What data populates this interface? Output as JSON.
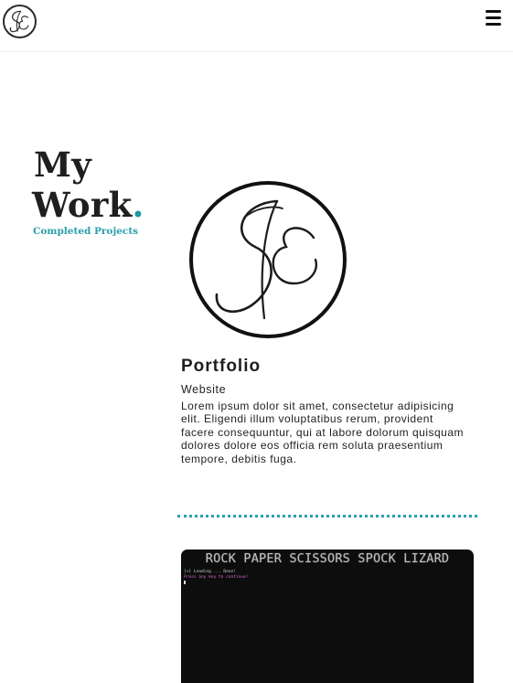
{
  "header": {
    "logo_monogram": "SE",
    "menu_icon": "hamburger-menu-icon"
  },
  "hero": {
    "title_line1": "My",
    "title_line2": "Work",
    "title_dot": ".",
    "subtitle": "Completed Projects",
    "accent_color": "#2aa0ab"
  },
  "projects": [
    {
      "image": "se-monogram-logo",
      "title": "Portfolio",
      "tag": "Website",
      "description": "Lorem ipsum dolor sit amet, consectetur adipisicing elit. Eligendi illum voluptatibus rerum, provident facere consequuntur, qui at labore dolorum quisquam dolores dolore eos officia rem soluta praesentium tempore, debitis fuga."
    },
    {
      "image": "terminal-screenshot",
      "screen_title": "ROCK PAPER SCISSORS SPOCK LIZARD",
      "screen_line1": "[+] Loading ... Done!",
      "screen_line2": "Press any key to continue!"
    }
  ]
}
